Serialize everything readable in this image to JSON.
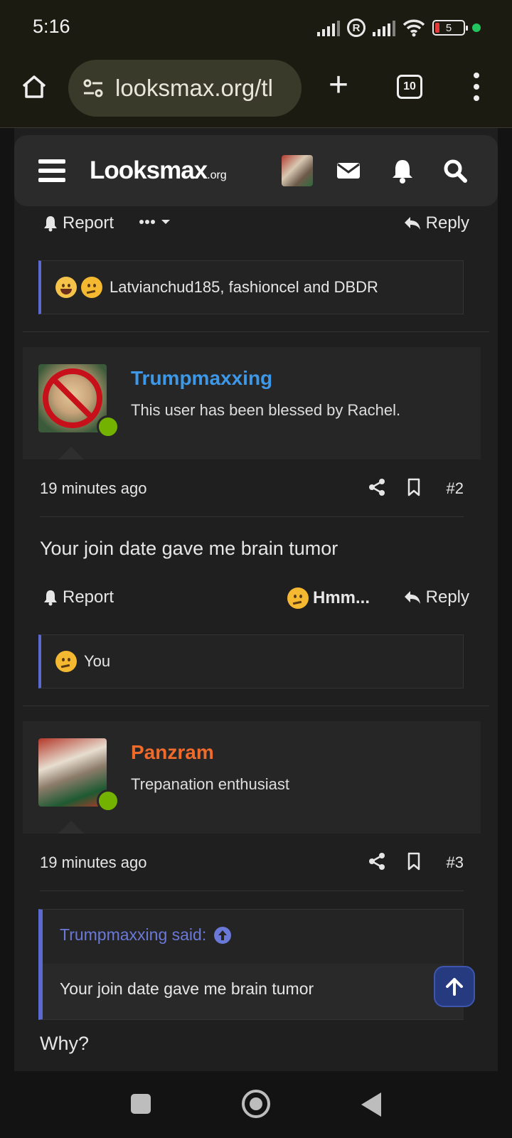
{
  "status_bar": {
    "time": "5:16",
    "battery": "5"
  },
  "browser": {
    "url": "looksmax.org/tl",
    "tab_count": "10"
  },
  "site": {
    "logo_main": "Looksmax",
    "logo_suffix": ".org"
  },
  "top_actions": {
    "report": "Report",
    "reply": "Reply"
  },
  "reactions_1": {
    "text": "Latvianchud185, fashioncel and DBDR"
  },
  "posts": [
    {
      "username": "Trumpmaxxing",
      "username_color": "#3d98e8",
      "user_title": "This user has been blessed by Rachel.",
      "time": "19 minutes ago",
      "number": "#2",
      "body": "Your join date gave me brain tumor",
      "report": "Report",
      "reaction_label": "Hmm...",
      "reply": "Reply",
      "reactions": "You"
    },
    {
      "username": "Panzram",
      "username_color": "#f06a2b",
      "user_title": "Trepanation enthusiast",
      "time": "19 minutes ago",
      "number": "#3",
      "quote_author": "Trumpmaxxing said:",
      "quote_text": "Your join date gave me brain tumor",
      "body": "Why?"
    }
  ],
  "colors": {
    "accent": "#5b6ad0",
    "online": "#73b200",
    "link": "#3d98e8"
  }
}
